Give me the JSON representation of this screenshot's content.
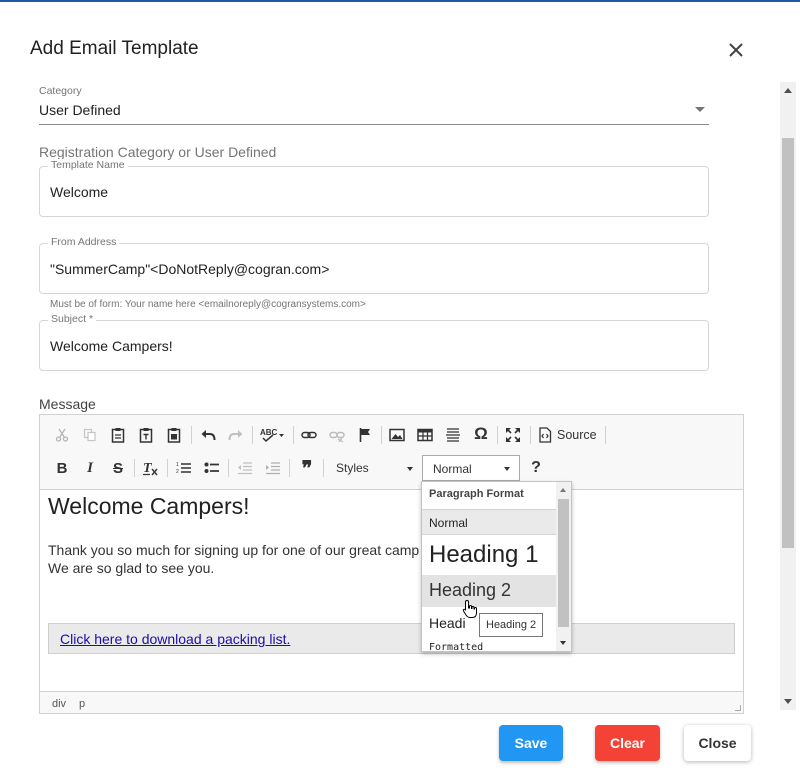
{
  "dialog": {
    "title": "Add Email Template"
  },
  "form": {
    "category": {
      "label": "Category",
      "value": "User Defined"
    },
    "category_helper": "Registration Category or User Defined",
    "template_name": {
      "label": "Template Name",
      "value": "Welcome"
    },
    "from_address": {
      "label": "From Address",
      "value": "\"SummerCamp\"<DoNotReply@cogran.com>",
      "hint": "Must be of form: Your name here <emailnoreply@cogransystems.com>"
    },
    "subject": {
      "label": "Subject *",
      "value": "Welcome Campers!"
    },
    "message_label": "Message"
  },
  "toolbar": {
    "source_label": "Source",
    "styles_label": "Styles",
    "format_value": "Normal",
    "help_label": "?"
  },
  "editor": {
    "heading": "Welcome Campers!",
    "line1": "Thank you so much for signing up for one of our great camp",
    "line2": "We are so glad to see you.",
    "link_text": "Click here to download a packing list. ",
    "path": [
      "div",
      "p"
    ]
  },
  "format_dropdown": {
    "header": "Paragraph Format",
    "items": [
      "Normal",
      "Heading 1",
      "Heading 2",
      "Headi",
      "Formatted"
    ],
    "highlighted": "Heading 2",
    "tooltip": "Heading 2"
  },
  "buttons": {
    "save": "Save",
    "clear": "Clear",
    "close": "Close"
  },
  "colors": {
    "save": "#2196f3",
    "clear": "#f44336",
    "link": "#1a0dab"
  }
}
